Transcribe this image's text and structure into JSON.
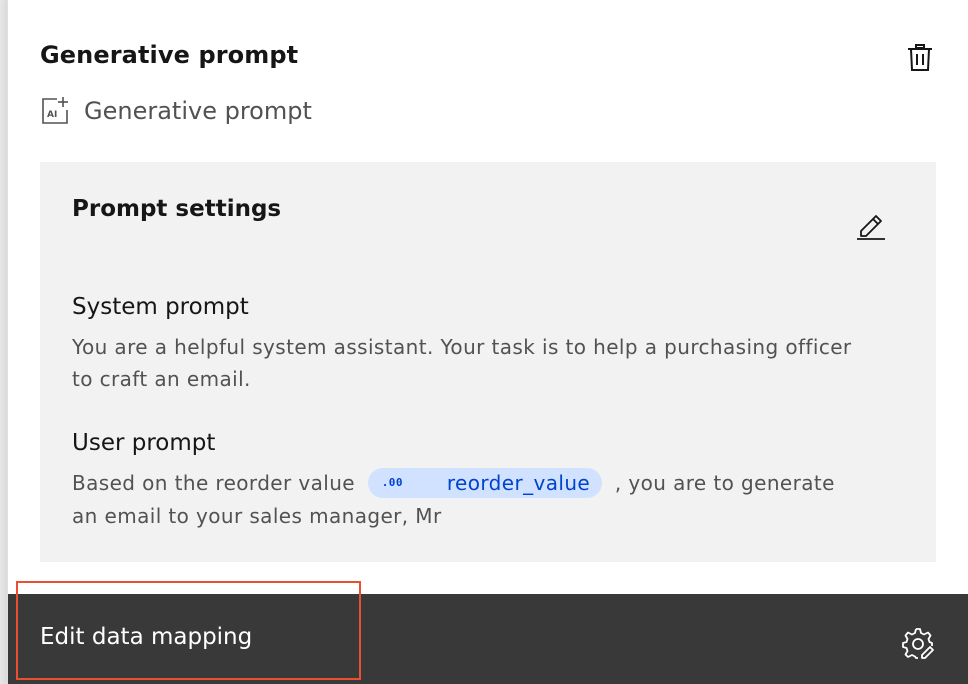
{
  "panel": {
    "title": "Generative prompt",
    "subtitle": "Generative prompt",
    "subtitle_icon": "ai-generate-icon",
    "delete_icon": "trash-can-icon"
  },
  "settings": {
    "title": "Prompt settings",
    "edit_icon": "pencil-edit-icon",
    "system_prompt": {
      "label": "System prompt",
      "text": "You are a helpful system assistant. Your task is to help a purchasing officer to craft an email."
    },
    "user_prompt": {
      "label": "User prompt",
      "text_before": "Based on the reorder value",
      "variable": {
        "icon_text": ".00",
        "name": "reorder_value"
      },
      "text_after": ", you are to generate an email to your sales manager, Mr"
    }
  },
  "footer": {
    "label": "Edit data mapping",
    "settings_icon": "gear-edit-icon"
  },
  "colors": {
    "footer_bg": "#393939",
    "settings_bg": "#f2f2f2",
    "chip_bg": "#d0e2ff",
    "chip_text": "#0043ce",
    "highlight": "#e8502f"
  }
}
